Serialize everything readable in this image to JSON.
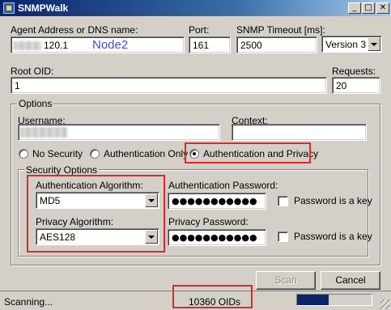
{
  "window": {
    "title": "SNMPWalk",
    "minimize_glyph": "_",
    "maximize_glyph": "□",
    "close_glyph": "✕"
  },
  "agent": {
    "label": "Agent Address or DNS name:",
    "value": "120.1",
    "annotation": "Node2",
    "annotation_color": "#4a4ac8"
  },
  "port": {
    "label": "Port:",
    "value": "161"
  },
  "timeout": {
    "label": "SNMP Timeout [ms]:",
    "value": "2500"
  },
  "version": {
    "selected": "Version 3"
  },
  "root_oid": {
    "label": "Root OID:",
    "value": "1"
  },
  "requests": {
    "label": "Requests:",
    "value": "20"
  },
  "options": {
    "title": "Options",
    "username_label": "Username:",
    "context_label": "Context:",
    "context_value": "",
    "security_modes": [
      {
        "label": "No Security",
        "selected": false
      },
      {
        "label": "Authentication Only",
        "selected": false
      },
      {
        "label": "Authentication and Privacy",
        "selected": true
      }
    ]
  },
  "security_options": {
    "title": "Security Options",
    "auth_algorithm_label": "Authentication Algorithm:",
    "auth_algorithm_value": "MD5",
    "privacy_algorithm_label": "Privacy Algorithm:",
    "privacy_algorithm_value": "AES128",
    "auth_password_label": "Authentication Password:",
    "auth_password_mask": "●●●●●●●●●●●",
    "privacy_password_label": "Privacy Password:",
    "privacy_password_mask": "●●●●●●●●●●●",
    "auth_key_label": "Password is a key",
    "privacy_key_label": "Password is a key",
    "auth_key_checked": false,
    "privacy_key_checked": false
  },
  "buttons": {
    "scan": "Scan",
    "cancel": "Cancel"
  },
  "status": {
    "text": "Scanning...",
    "oid_count": "10360 OIDs",
    "progress_fraction": 0.42
  },
  "colors": {
    "highlight": "#e2252b",
    "titlebar_start": "#0a246a",
    "progress": "#0a246a"
  }
}
